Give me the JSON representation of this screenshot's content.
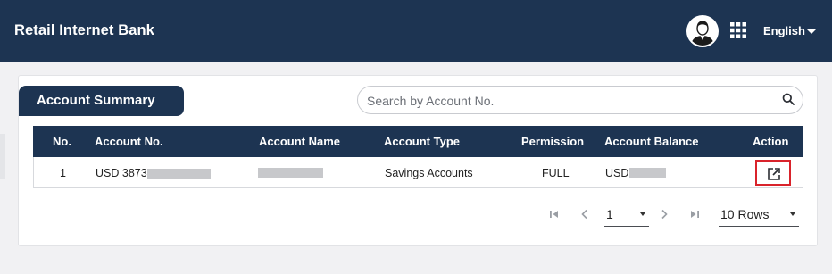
{
  "header": {
    "title": "Retail Internet Bank",
    "language": "English"
  },
  "summary": {
    "tab_label": "Account Summary",
    "search_placeholder": "Search by Account No."
  },
  "table": {
    "columns": [
      "No.",
      "Account No.",
      "Account Name",
      "Account Type",
      "Permission",
      "Account Balance",
      "Action"
    ],
    "rows": [
      {
        "no": "1",
        "account_no": "USD 3873-",
        "account_name": "",
        "account_type": "Savings Accounts",
        "permission": "FULL",
        "account_balance": "USD"
      }
    ]
  },
  "pagination": {
    "page": "1",
    "rows_per_page": "10 Rows"
  },
  "colors": {
    "navy": "#1d3452",
    "action_highlight": "#d9232b",
    "redacted": "#c7c8cb"
  }
}
